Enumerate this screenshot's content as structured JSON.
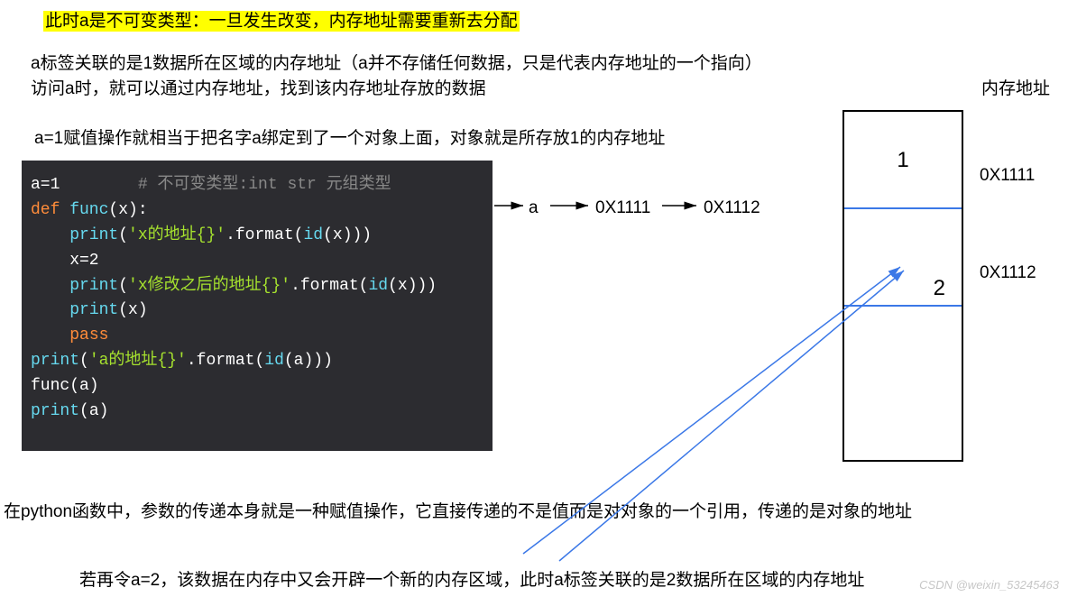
{
  "title_highlight": "此时a是不可变类型：一旦发生改变，内存地址需要重新去分配",
  "desc_line1": "a标签关联的是1数据所在区域的内存地址（a并不存储任何数据，只是代表内存地址的一个指向）",
  "desc_line2": "访问a时，就可以通过内存地址，找到该内存地址存放的数据",
  "desc_line3": "a=1赋值操作就相当于把名字a绑定到了一个对象上面，对象就是所存放1的内存地址",
  "mem_header": "内存地址",
  "addr_1": "0X1111",
  "addr_2": "0X1112",
  "var_a": "a",
  "ptr_1": "0X1111",
  "ptr_2": "0X1112",
  "bottom_line1": "在python函数中，参数的传递本身就是一种赋值操作，它直接传递的不是值而是对对象的一个引用，传递的是对象的地址",
  "bottom_line2": "若再令a=2，该数据在内存中又会开辟一个新的内存区域，此时a标签关联的是2数据所在区域的内存地址",
  "cell_value_1": "1",
  "cell_value_2": "2",
  "code": {
    "l1_a": "a=1        ",
    "l1_c": "# 不可变类型:int str 元组类型",
    "l2_def": "def",
    "l2_fn": " func",
    "l2_rest": "(x):",
    "l3_i": "    ",
    "l3_p": "print",
    "l3_paren": "(",
    "l3_s": "'x的地址{}'",
    "l3_rest": ".format(",
    "l3_id": "id",
    "l3_tail": "(x)))",
    "l4": "    x=2",
    "l5_i": "    ",
    "l5_p": "print",
    "l5_paren": "(",
    "l5_s": "'x修改之后的地址{}'",
    "l5_rest": ".format(",
    "l5_id": "id",
    "l5_tail": "(x)))",
    "l6_i": "    ",
    "l6_p": "print",
    "l6_rest": "(x)",
    "l7_i": "    ",
    "l7_pass": "pass",
    "l8_p": "print",
    "l8_paren": "(",
    "l8_s": "'a的地址{}'",
    "l8_rest": ".format(",
    "l8_id": "id",
    "l8_tail": "(a)))",
    "l9": "func(a)",
    "l10_p": "print",
    "l10_rest": "(a)"
  },
  "watermark": "CSDN @weixin_53245463"
}
